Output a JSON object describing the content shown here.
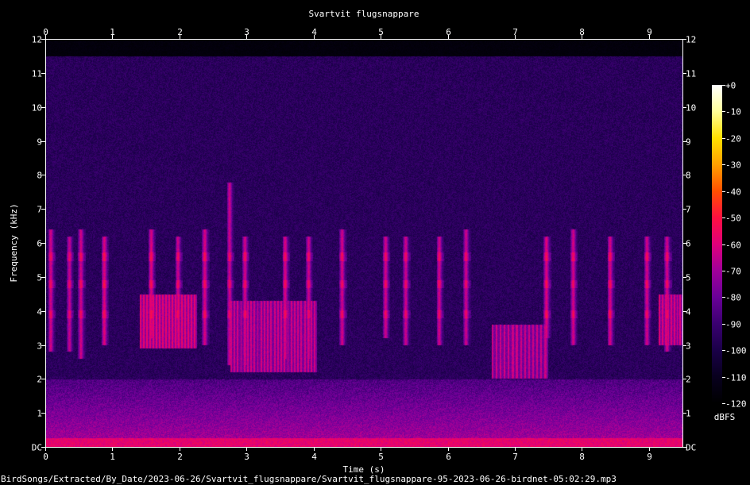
{
  "chart_data": {
    "type": "heatmap",
    "title": "Svartvit flugsnappare",
    "xlabel": "Time (s)",
    "ylabel": "Frequency (kHz)",
    "xlim": [
      0,
      9.5
    ],
    "ylim": [
      0,
      12
    ],
    "x_ticks": [
      "0",
      "1",
      "2",
      "3",
      "4",
      "5",
      "6",
      "7",
      "8",
      "9"
    ],
    "y_ticks": [
      "DC",
      "1",
      "2",
      "3",
      "4",
      "5",
      "6",
      "7",
      "8",
      "9",
      "10",
      "11",
      "12"
    ],
    "y_ticks_right": [
      "DC",
      "1",
      "2",
      "3",
      "4",
      "5",
      "6",
      "7",
      "8",
      "9",
      "10",
      "11",
      "12"
    ],
    "colorbar": {
      "label": "dBFS",
      "range": [
        -120,
        0
      ],
      "ticks": [
        "+0",
        "-10",
        "-20",
        "-30",
        "-40",
        "-50",
        "-60",
        "-70",
        "-80",
        "-90",
        "-100",
        "-110",
        "-120"
      ],
      "colors": [
        "#ffffff",
        "#ffff99",
        "#ffe000",
        "#ffa000",
        "#ff5000",
        "#ff1040",
        "#e0007a",
        "#a0009a",
        "#6a0098",
        "#3a0070",
        "#1a0048",
        "#08001e",
        "#000000"
      ]
    },
    "spectrogram": {
      "noise_floor_db": -95,
      "noise_cutoff_khz": 11.5,
      "low_band_db": -68,
      "low_band_top_khz": 2.0,
      "tonal_lines_khz": [
        4.8,
        5.6,
        3.9
      ],
      "syllables": [
        {
          "t": 0.05,
          "f_low": 2.8,
          "f_high": 6.4,
          "db": -62
        },
        {
          "t": 0.33,
          "f_low": 2.8,
          "f_high": 6.2,
          "db": -64
        },
        {
          "t": 0.5,
          "f_low": 2.6,
          "f_high": 6.4,
          "db": -62
        },
        {
          "t": 0.85,
          "f_low": 3.0,
          "f_high": 6.2,
          "db": -60
        },
        {
          "t": 1.55,
          "f_low": 3.2,
          "f_high": 6.4,
          "db": -60
        },
        {
          "t": 1.95,
          "f_low": 3.0,
          "f_high": 6.2,
          "db": -63
        },
        {
          "t": 2.35,
          "f_low": 3.0,
          "f_high": 6.4,
          "db": -61
        },
        {
          "t": 2.72,
          "f_low": 2.4,
          "f_high": 7.8,
          "db": -63
        },
        {
          "t": 2.95,
          "f_low": 2.4,
          "f_high": 6.2,
          "db": -62
        },
        {
          "t": 3.55,
          "f_low": 2.6,
          "f_high": 6.2,
          "db": -61
        },
        {
          "t": 3.9,
          "f_low": 2.6,
          "f_high": 6.2,
          "db": -63
        },
        {
          "t": 4.4,
          "f_low": 3.0,
          "f_high": 6.4,
          "db": -62
        },
        {
          "t": 5.05,
          "f_low": 3.2,
          "f_high": 6.2,
          "db": -62
        },
        {
          "t": 5.35,
          "f_low": 3.0,
          "f_high": 6.2,
          "db": -63
        },
        {
          "t": 5.85,
          "f_low": 3.0,
          "f_high": 6.2,
          "db": -62
        },
        {
          "t": 6.25,
          "f_low": 3.0,
          "f_high": 6.4,
          "db": -63
        },
        {
          "t": 7.45,
          "f_low": 3.2,
          "f_high": 6.2,
          "db": -60
        },
        {
          "t": 7.85,
          "f_low": 3.0,
          "f_high": 6.4,
          "db": -62
        },
        {
          "t": 8.4,
          "f_low": 3.0,
          "f_high": 6.2,
          "db": -61
        },
        {
          "t": 8.95,
          "f_low": 3.0,
          "f_high": 6.2,
          "db": -62
        },
        {
          "t": 9.25,
          "f_low": 2.8,
          "f_high": 6.2,
          "db": -62
        }
      ],
      "trill_blocks": [
        {
          "t_start": 1.4,
          "t_end": 2.25,
          "f_low": 2.9,
          "f_high": 4.5,
          "db": -58,
          "pulses": 18
        },
        {
          "t_start": 2.75,
          "t_end": 4.05,
          "f_low": 2.2,
          "f_high": 4.3,
          "db": -62,
          "pulses": 26
        },
        {
          "t_start": 6.65,
          "t_end": 7.5,
          "f_low": 2.0,
          "f_high": 3.6,
          "db": -63,
          "pulses": 14
        },
        {
          "t_start": 9.15,
          "t_end": 9.5,
          "f_low": 3.0,
          "f_high": 4.5,
          "db": -60,
          "pulses": 8
        }
      ]
    }
  },
  "footer": {
    "file_path": "BirdSongs/Extracted/By_Date/2023-06-26/Svartvit_flugsnappare/Svartvit_flugsnappare-95-2023-06-26-birdnet-05:02:29.mp3"
  }
}
